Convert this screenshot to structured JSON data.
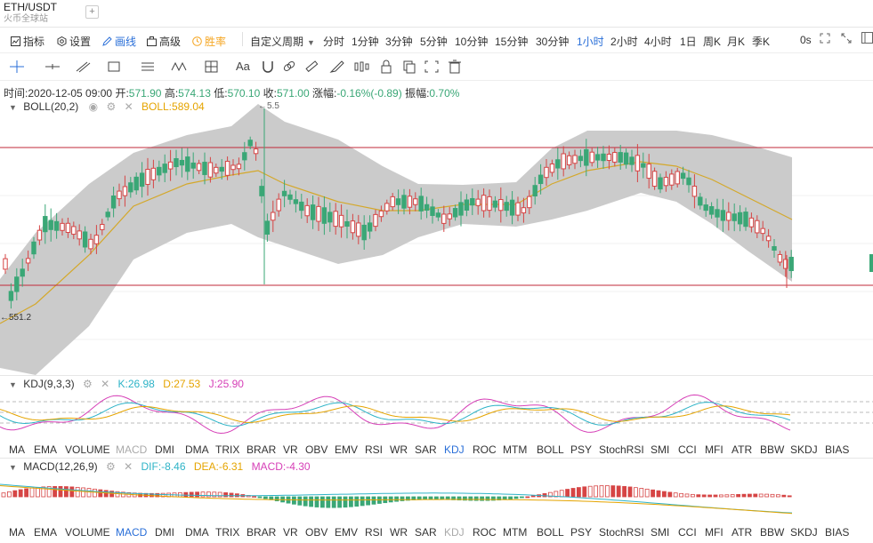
{
  "tab": {
    "title": "ETH/USDT",
    "subtitle": "火币全球站",
    "add": "+"
  },
  "toolbar": {
    "indicator": "指标",
    "settings": "设置",
    "draw": "画线",
    "advanced": "高级",
    "win_rate": "胜率",
    "custom_period": "自定义周期",
    "periods": [
      "分时",
      "1分钟",
      "3分钟",
      "5分钟",
      "10分钟",
      "15分钟",
      "30分钟",
      "1小时",
      "2小时",
      "4小时",
      "1日",
      "周K",
      "月K",
      "季K"
    ],
    "active_period": "1小时",
    "right_label": "0s"
  },
  "info": {
    "time_label": "时间:",
    "time": "2020-12-05 09:00",
    "open_label": "开:",
    "open": "571.90",
    "high_label": "高:",
    "high": "574.13",
    "low_label": "低:",
    "low": "570.10",
    "close_label": "收:",
    "close": "571.00",
    "change_label": "涨幅:",
    "change": "-0.16%(-0.89)",
    "amp_label": "振幅:",
    "amp": "0.70%"
  },
  "boll": {
    "name": "BOLL(20,2)",
    "value": "BOLL:589.04",
    "low_mark": "551.2",
    "high_mark": "5.5"
  },
  "kdj": {
    "name": "KDJ(9,3,3)",
    "k": "K:26.98",
    "d": "D:27.53",
    "j": "J:25.90"
  },
  "macd": {
    "name": "MACD(12,26,9)",
    "dif": "DIF:-8.46",
    "dea": "DEA:-6.31",
    "macd": "MACD:-4.30"
  },
  "indicators": [
    "MA",
    "EMA",
    "VOLUME",
    "MACD",
    "DMI",
    "DMA",
    "TRIX",
    "BRAR",
    "VR",
    "OBV",
    "EMV",
    "RSI",
    "WR",
    "SAR",
    "KDJ",
    "ROC",
    "MTM",
    "BOLL",
    "PSY",
    "StochRSI",
    "SMI",
    "CCI",
    "MFI",
    "ATR",
    "BBW",
    "SKDJ",
    "BIAS"
  ],
  "colors": {
    "up": "#d64545",
    "down": "#3aa776",
    "blue": "#2a6fd8",
    "orange": "#f5a623",
    "boll_mid": "#d4a82a",
    "band": "#c8c8c8",
    "hline": "#c0283a"
  }
}
